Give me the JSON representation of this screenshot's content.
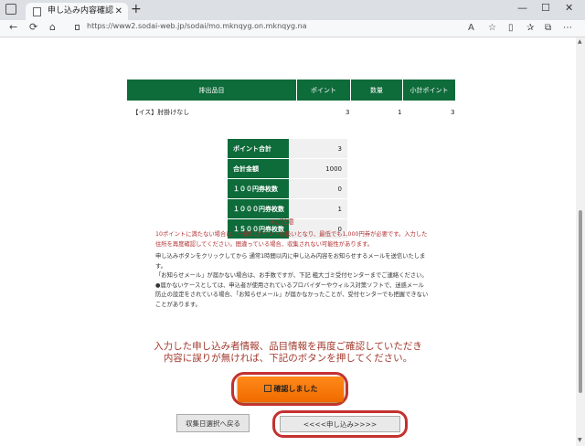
{
  "browser": {
    "tab_title": "申し込み内容確認",
    "tab_close": "✕",
    "new_tab": "+",
    "win_min": "—",
    "win_max": "☐",
    "win_close": "✕",
    "url": "https://www2.sodai-web.jp/sodai/mo.mknqyg.on.mknqyg.na"
  },
  "items_table": {
    "headers": [
      "排出品目",
      "ポイント",
      "数量",
      "小計ポイント"
    ],
    "rows": [
      {
        "item": "【イス】肘掛けなし",
        "points": "3",
        "qty": "1",
        "subtotal": "3"
      }
    ]
  },
  "summary": [
    {
      "label": "ポイント合計",
      "value": "3"
    },
    {
      "label": "合計金額",
      "value": "1000"
    },
    {
      "label": "１００円券枚数",
      "value": "0"
    },
    {
      "label": "１０００円券枚数",
      "value": "1"
    },
    {
      "label": "１５００円券枚数",
      "value": "0"
    }
  ],
  "notice": {
    "title": "※ご注意",
    "red": "10ポイントに満たない場合は、一律10ポイントの扱いとなり、最低でも1,000円券が必要です。入力した住所を再度確認してください。間違っている場合、収集されない可能性があります。",
    "lines": [
      "申し込みボタンをクリックしてから 通常1時間以内に申し込み内容をお知らせするメールを送信いたします。",
      "「お知らせメール」が届かない場合は、お手数ですが、下記 粗大ゴミ受付センターまでご連絡ください。",
      "●届かないケースとしては、申込者が使用されているプロバイダーやウィルス対策ソフトで、迷惑メール防止の設定をされている場合、「お知らせメール」が届かなかったことが、受付センターでも把握できないことがあります。"
    ]
  },
  "confirm_message": {
    "line1": "入力した申し込み者情報、品目情報を再度ご確認していただき",
    "line2": "内容に誤りが無ければ、下記のボタンを押してください。"
  },
  "buttons": {
    "confirm": "確認しました",
    "back": "収集日選択へ戻る",
    "submit": "<<<<申し込み>>>>"
  }
}
